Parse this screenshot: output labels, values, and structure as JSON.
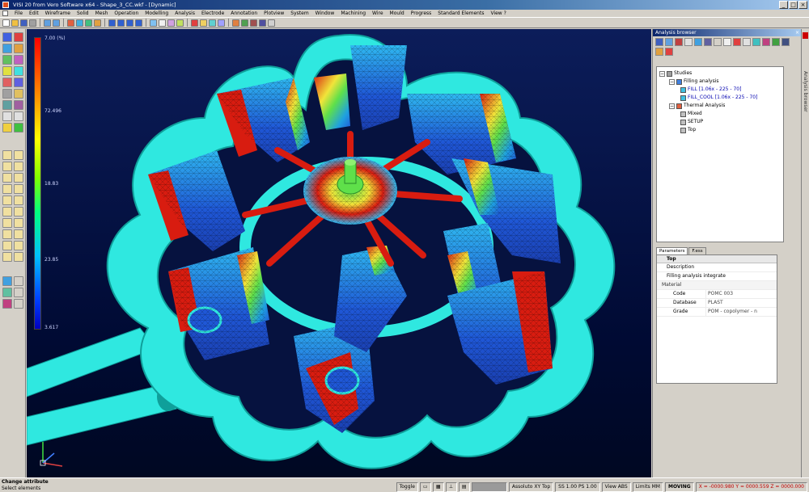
{
  "window": {
    "title": "VISI 20 from Vero Software x64 - Shape_3_CC.wkf - [Dynamic]",
    "controls": [
      "_",
      "□",
      "×"
    ]
  },
  "menu": [
    "File",
    "Edit",
    "Wireframe",
    "Solid",
    "Mesh",
    "Operation",
    "Modelling",
    "Analysis",
    "Electrode",
    "Annotation",
    "Plotview",
    "System",
    "Window",
    "Machining",
    "Wire",
    "Mould",
    "Progress",
    "Standard Elements",
    "View ?"
  ],
  "viewport": {
    "scale_labels": [
      "7.00 (%)",
      "72.496",
      "18.83",
      "23.85",
      "3.617"
    ]
  },
  "browser": {
    "title": "Analysis browser",
    "tree": [
      {
        "label": "Studies",
        "depth": 0,
        "expander": "−"
      },
      {
        "label": "Filling analysis",
        "depth": 1,
        "expander": "−"
      },
      {
        "label": "FILL [1.06x - 225 - 70]",
        "depth": 2,
        "expander": "",
        "blue": true
      },
      {
        "label": "FILL_COOL [1.06x - 225 - 70]",
        "depth": 2,
        "expander": "",
        "blue": true
      },
      {
        "label": "Thermal Analysis",
        "depth": 1,
        "expander": "−"
      },
      {
        "label": "Mixed",
        "depth": 2,
        "expander": ""
      },
      {
        "label": "SETUP",
        "depth": 2,
        "expander": ""
      },
      {
        "label": "Top",
        "depth": 2,
        "expander": ""
      }
    ]
  },
  "properties": {
    "tabs": [
      "Parameters",
      "F.ess"
    ],
    "header": "Top",
    "rows_top": [
      {
        "key": "Description",
        "value": ""
      },
      {
        "key": "Filling analysis integrate",
        "value": ""
      }
    ],
    "group": "Material",
    "rows_material": [
      {
        "key": "Code",
        "value": "POMC 003"
      },
      {
        "key": "Database",
        "value": "PLAST"
      },
      {
        "key": "Grade",
        "value": "POM - copolymer - n"
      }
    ]
  },
  "side_strip": {
    "label": "Analysis browser"
  },
  "status": {
    "line1": "Change attribute",
    "line2": "Select elements",
    "toggle": "Toggle",
    "coord_system": "Assoluto XY Top",
    "scale": "SS 1.00 PS 1.00",
    "view": "View ABS",
    "units": "Limits MM",
    "mode": "MOVING",
    "coords": "X = -0000.980  Y = 0000.559  Z = 0000.000"
  },
  "colors": {
    "viewport_bg": "#06123f",
    "ring": "#2fe8e0",
    "ring_shade": "#0f9f9a",
    "part_blue": "#1f57d6",
    "part_red": "#d81c10",
    "hot_green": "#5fe04a",
    "hot_yellow": "#f1e43a"
  },
  "icons": {
    "toolbar": [
      "new-icon",
      "open-icon",
      "save-icon",
      "print-icon",
      "undo-icon",
      "redo-icon",
      "zoom-icon",
      "rotate-icon",
      "view-icon",
      "shade-icon",
      "layer-icon",
      "attribute-icon"
    ],
    "left": [
      "point-icon",
      "line-icon",
      "arc-icon",
      "circle-icon",
      "rect-icon",
      "solid-icon",
      "cube-icon",
      "sphere-icon",
      "fillet-icon",
      "chamfer-icon",
      "measure-icon",
      "text-icon"
    ]
  }
}
